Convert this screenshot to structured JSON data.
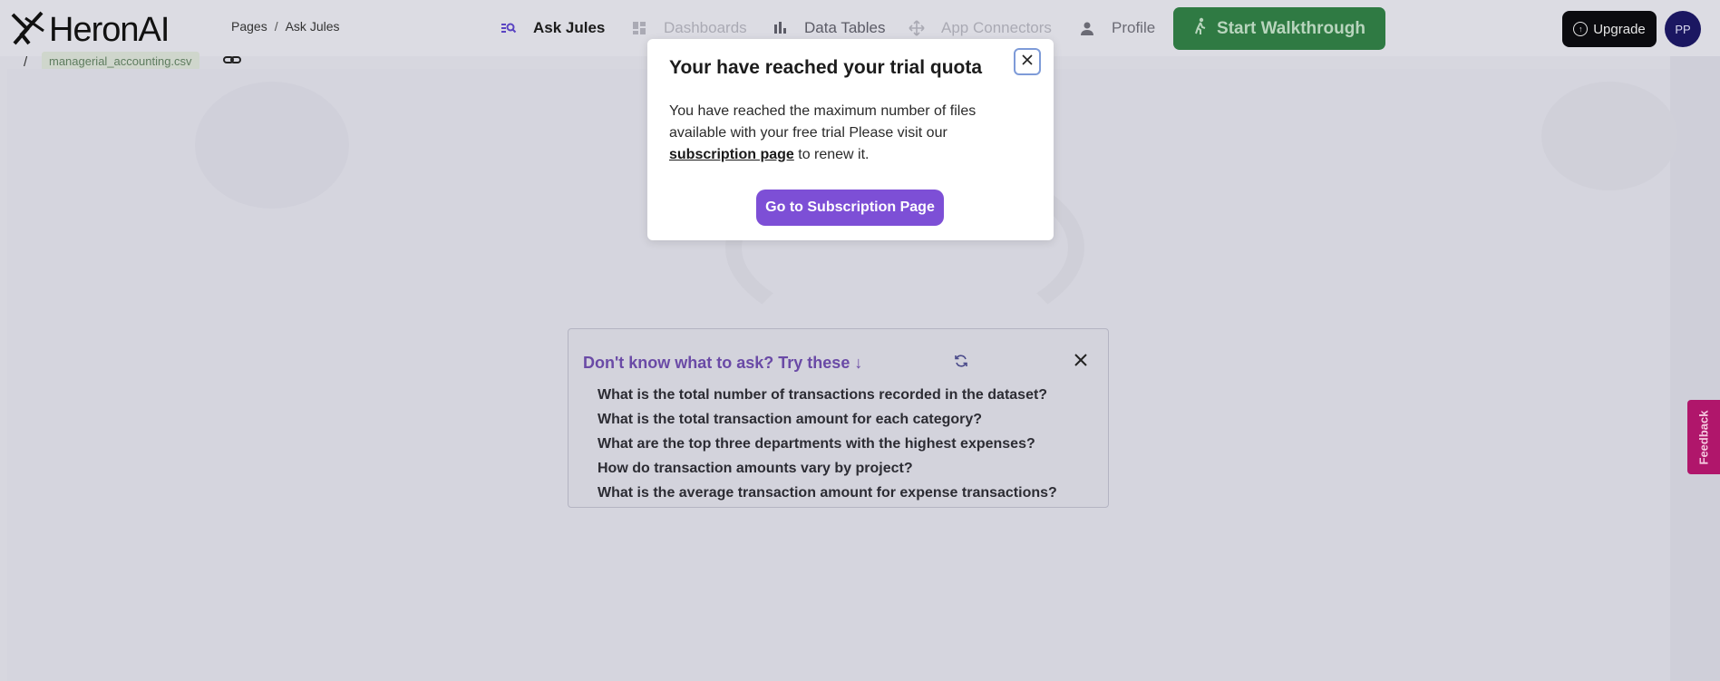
{
  "brand": {
    "name": "HeronAI"
  },
  "breadcrumb": {
    "root": "Pages",
    "separator": "/",
    "current": "Ask Jules"
  },
  "nav": {
    "ask_jules": "Ask Jules",
    "dashboards": "Dashboards",
    "data_tables": "Data Tables",
    "app_connectors": "App Connectors",
    "profile": "Profile"
  },
  "header_actions": {
    "walkthrough_label": "Start Walkthrough",
    "upgrade_label": "Upgrade",
    "avatar_initials": "PP"
  },
  "subbar": {
    "slash": "/",
    "file_name": "managerial_accounting.csv"
  },
  "suggestions": {
    "title": "Don't know what to ask? Try these ↓",
    "items": [
      "What is the total number of transactions recorded in the dataset?",
      "What is the total transaction amount for each category?",
      "What are the top three departments with the highest expenses?",
      "How do transaction amounts vary by project?",
      "What is the average transaction amount for expense transactions?"
    ]
  },
  "feedback": {
    "label": "Feedback"
  },
  "modal": {
    "title": "Your have reached your trial quota",
    "body_before": "You have reached the maximum number of files available with your free trial Please visit our ",
    "link_text": "subscription page",
    "body_after": " to renew it.",
    "button_label": "Go to Subscription Page"
  },
  "colors": {
    "accent_purple": "#7d4fd6",
    "walkthrough_green": "#2f7a43",
    "feedback_magenta": "#b0166b",
    "avatar_navy": "#1b1761"
  },
  "icons": {
    "logo": "heron-logo-icon",
    "ask_jules": "search-list-icon",
    "dashboards": "grid-icon",
    "data_tables": "bar-chart-icon",
    "app_connectors": "move-icon",
    "profile": "person-icon",
    "walkthrough": "walking-person-icon",
    "upgrade": "arrow-up-circle-icon",
    "refresh": "refresh-icon",
    "close": "close-icon",
    "link": "link-icon"
  }
}
